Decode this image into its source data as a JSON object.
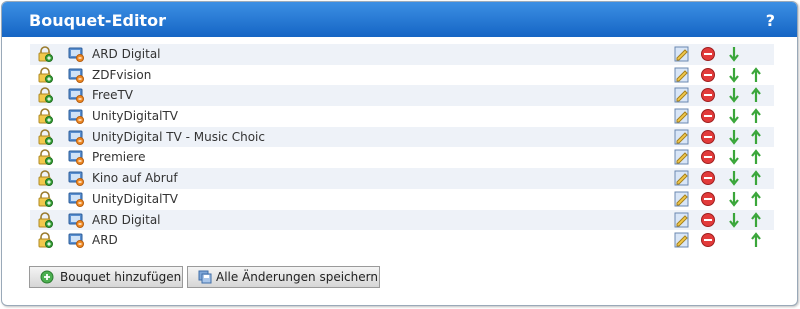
{
  "header": {
    "title": "Bouquet-Editor",
    "help": "?"
  },
  "bouquets": [
    {
      "name": "ARD Digital",
      "can_move_down": true,
      "can_move_up": false
    },
    {
      "name": "ZDFvision",
      "can_move_down": true,
      "can_move_up": true
    },
    {
      "name": "FreeTV",
      "can_move_down": true,
      "can_move_up": true
    },
    {
      "name": "UnityDigitalTV",
      "can_move_down": true,
      "can_move_up": true
    },
    {
      "name": "UnityDigital TV - Music Choic",
      "can_move_down": true,
      "can_move_up": true
    },
    {
      "name": "Premiere",
      "can_move_down": true,
      "can_move_up": true
    },
    {
      "name": "Kino auf Abruf",
      "can_move_down": true,
      "can_move_up": true
    },
    {
      "name": "UnityDigitalTV",
      "can_move_down": true,
      "can_move_up": true
    },
    {
      "name": "ARD Digital",
      "can_move_down": true,
      "can_move_up": true
    },
    {
      "name": "ARD",
      "can_move_down": false,
      "can_move_up": true
    }
  ],
  "buttons": {
    "add_bouquet": "Bouquet hinzufügen",
    "save_all": "Alle Änderungen speichern"
  },
  "colors": {
    "header": "#1f6fd0",
    "row_alt": "#eef2f8",
    "delete": "#e23b3b",
    "arrows": "#3aa63a"
  },
  "icons": {
    "lock": "lock-icon",
    "tv": "tv-icon",
    "edit": "edit-icon",
    "delete": "delete-icon",
    "down": "arrow-down-icon",
    "up": "arrow-up-icon"
  }
}
